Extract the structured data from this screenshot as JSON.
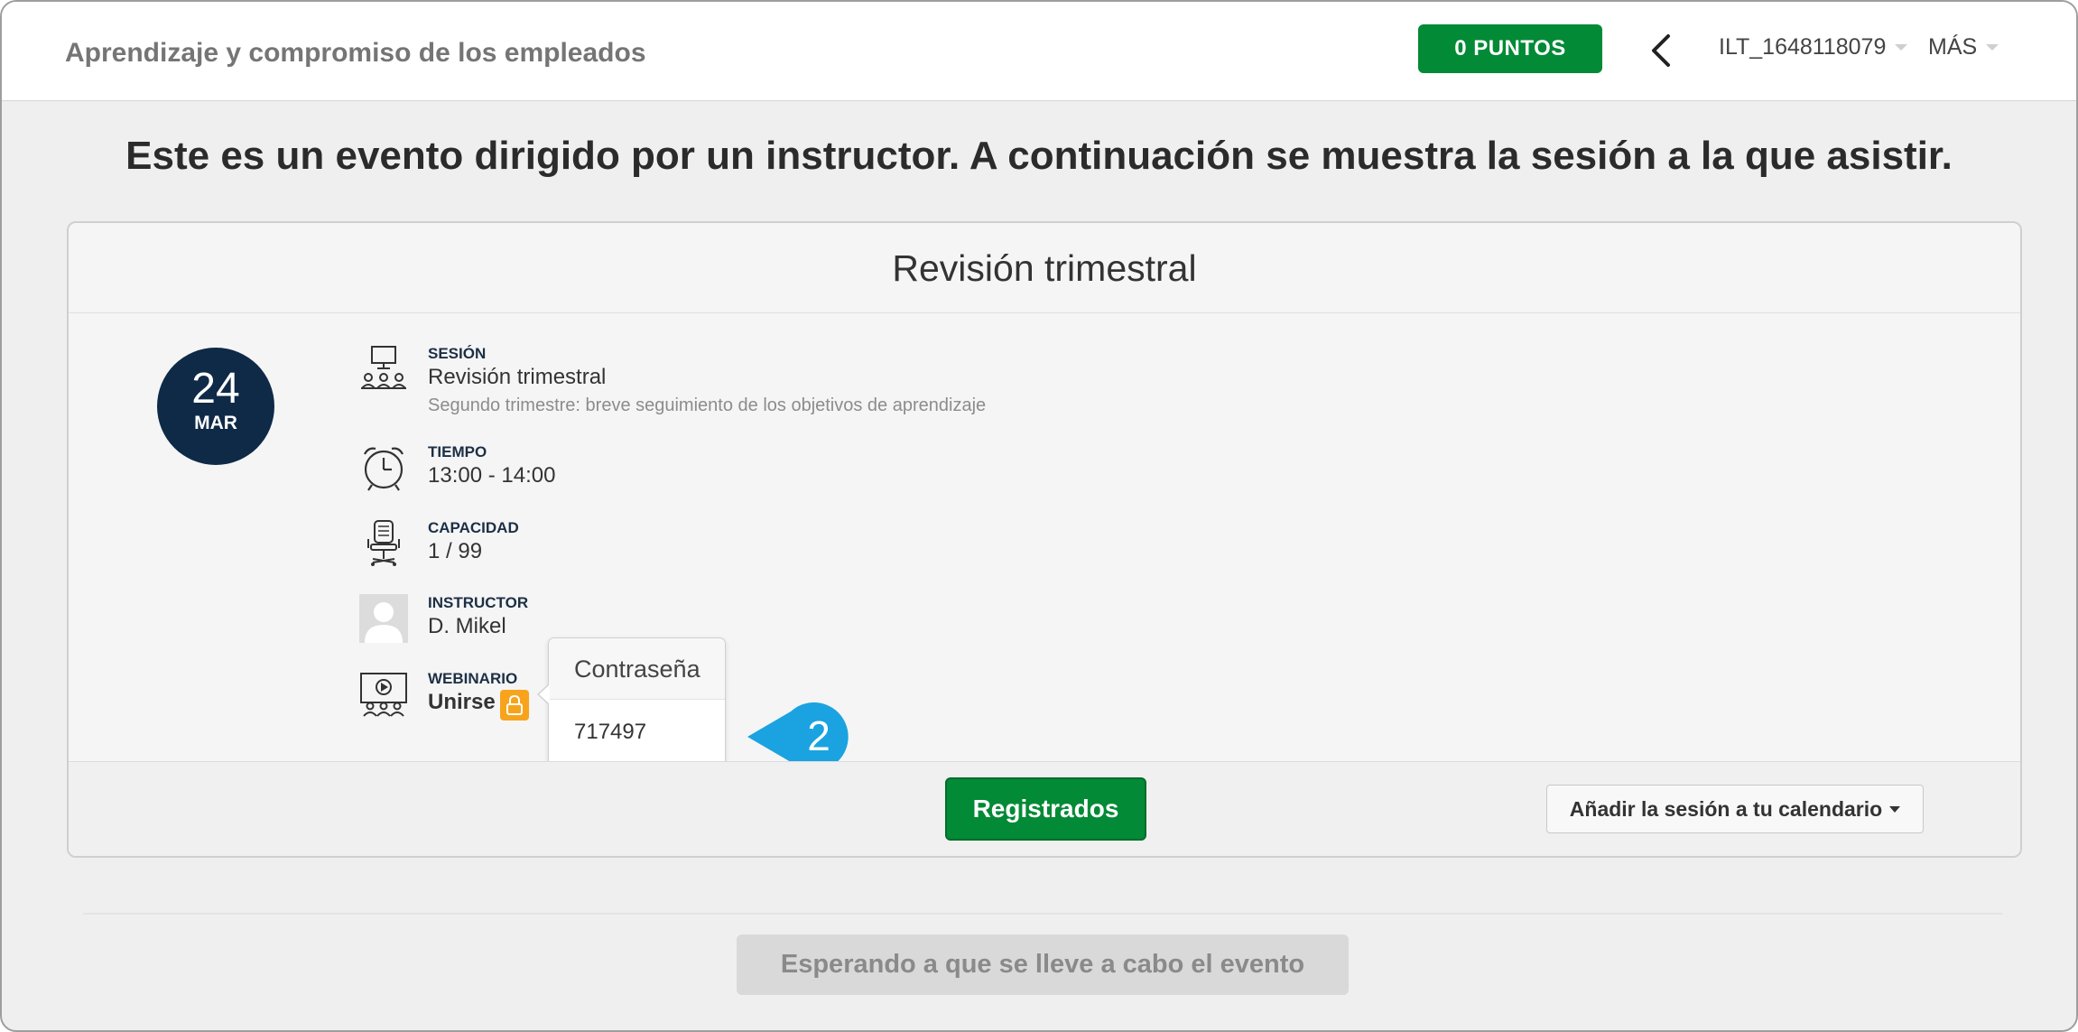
{
  "header": {
    "app_title": "Aprendizaje y compromiso de los empleados",
    "points_label": "0 PUNTOS",
    "user_label": "ILT_1648118079",
    "more_label": "MÁS"
  },
  "headline": "Este es un evento dirigido por un instructor. A continuación se muestra la sesión a la que asistir.",
  "session_card": {
    "title": "Revisión trimestral",
    "date": {
      "day": "24",
      "month": "MAR"
    },
    "session": {
      "label": "SESIÓN",
      "value": "Revisión trimestral",
      "description": "Segundo trimestre: breve seguimiento de los objetivos de aprendizaje"
    },
    "time": {
      "label": "TIEMPO",
      "value": "13:00 - 14:00"
    },
    "capacity": {
      "label": "CAPACIDAD",
      "value": "1 / 99"
    },
    "instructor": {
      "label": "INSTRUCTOR",
      "value": "D. Mikel"
    },
    "webinar": {
      "label": "WEBINARIO",
      "join_label": "Unirse"
    },
    "password_popover": {
      "title": "Contraseña",
      "value": "717497"
    },
    "registered_label": "Registrados",
    "calendar_label": "Añadir la sesión a tu calendario"
  },
  "step_marker": "2",
  "waiting_label": "Esperando a que se lleve a cabo el evento",
  "colors": {
    "brand_green": "#028a36",
    "date_badge": "#0e2a47",
    "lock_orange": "#f7a41c",
    "step_marker_blue": "#1aa3e0"
  }
}
